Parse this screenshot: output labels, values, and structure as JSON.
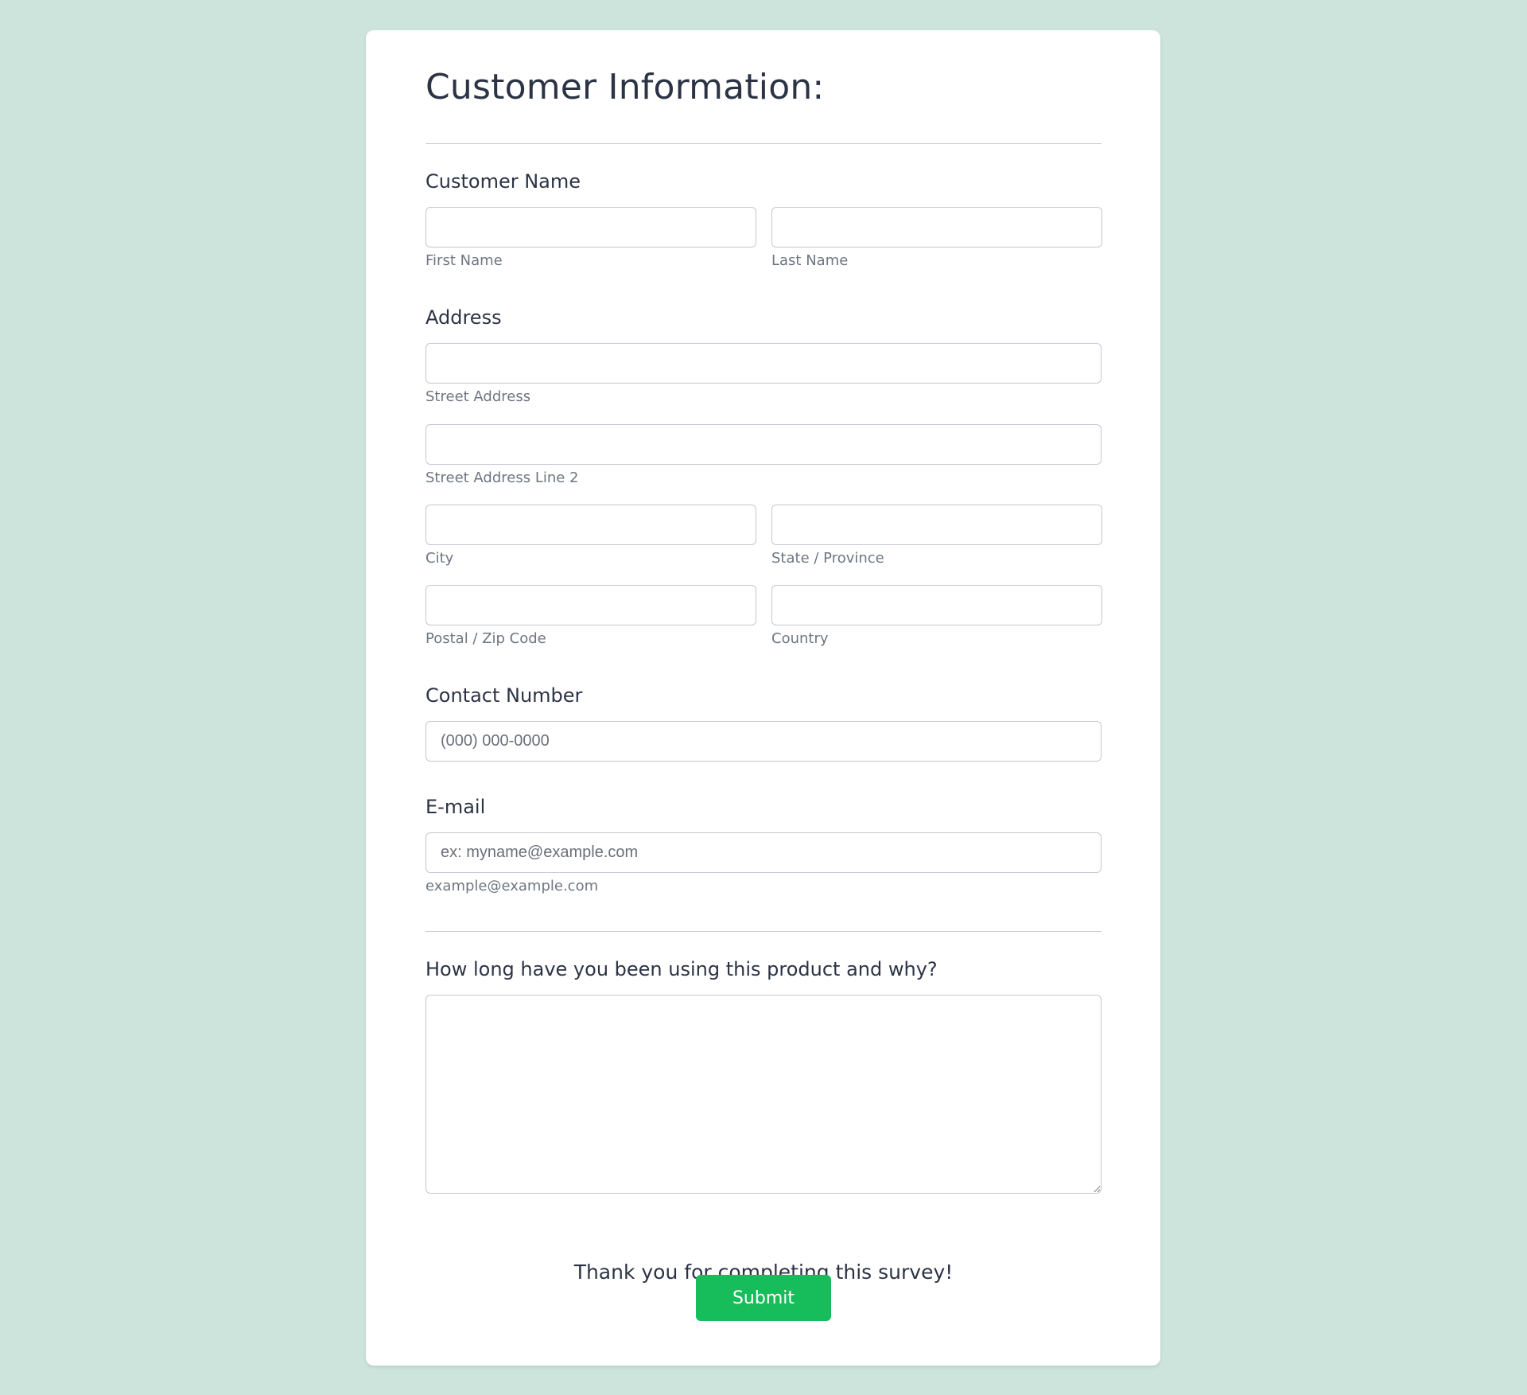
{
  "form": {
    "title": "Customer Information:",
    "customer_name": {
      "label": "Customer Name",
      "first_name_sublabel": "First Name",
      "last_name_sublabel": "Last Name",
      "first_name_value": "",
      "last_name_value": ""
    },
    "address": {
      "label": "Address",
      "street_sublabel": "Street Address",
      "street2_sublabel": "Street Address Line 2",
      "city_sublabel": "City",
      "state_sublabel": "State / Province",
      "postal_sublabel": "Postal / Zip Code",
      "country_sublabel": "Country"
    },
    "contact_number": {
      "label": "Contact Number",
      "placeholder": "(000) 000-0000"
    },
    "email": {
      "label": "E-mail",
      "placeholder": "ex: myname@example.com",
      "sublabel": "example@example.com"
    },
    "question": {
      "label": "How long have you been using this product and why?"
    },
    "thanks_text": "Thank you for completing this survey!",
    "submit_label": "Submit"
  },
  "colors": {
    "background": "#cde4dd",
    "submit_button": "#18bd5b",
    "text": "#2c3345"
  }
}
